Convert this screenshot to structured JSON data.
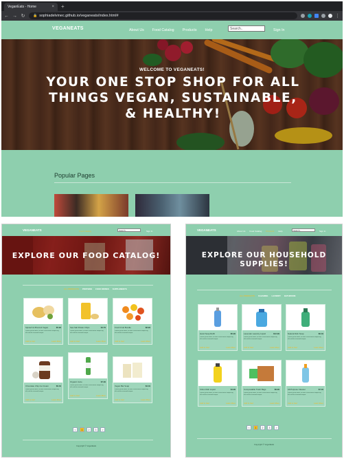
{
  "browser": {
    "tab_title": "VeganEats - Home",
    "tab_close": "×",
    "new_tab": "+",
    "url": "sophiadelvinec.github.io/veganeats/index.html#"
  },
  "site": {
    "brand": "VEGANEATS",
    "nav": [
      "About Us",
      "Food Catalog",
      "Products",
      "Help"
    ],
    "search_placeholder": "Search..",
    "signin": "Sign In"
  },
  "home": {
    "welcome": "WELCOME TO VEGANEATS!",
    "headline": "YOUR ONE STOP SHOP FOR ALL THINGS VEGAN, SUSTAINABLE, & HEALTHY!",
    "popular_heading": "Popular Pages"
  },
  "food_page": {
    "banner": "EXPLORE OUR FOOD CATALOG!",
    "tabs": [
      "ALL PRODUCTS",
      "PROTEINS",
      "FOOD DRINKS",
      "SUPPLEMENTS"
    ],
    "cards": [
      {
        "name": "Spinach & Broccoli Vegan",
        "price": "$5.99",
        "desc": "Lorem ipsum dolor sit amet consectetur adipiscing elit sed do eiusmod tempor.",
        "buy": "Add to Cart",
        "more": "Learn More"
      },
      {
        "name": "Sea Salt Potato Chips",
        "price": "$4.79",
        "desc": "Lorem ipsum dolor sit amet consectetur adipiscing elit sed do eiusmod tempor.",
        "buy": "Add to Cart",
        "more": "Learn More"
      },
      {
        "name": "Fresh Fruit Bundle",
        "price": "$8.99",
        "desc": "Lorem ipsum dolor sit amet consectetur adipiscing elit sed do eiusmod tempor.",
        "buy": "Add to Cart",
        "more": "Learn More"
      },
      {
        "name": "Chocolate Chip Ice Cream",
        "price": "$6.49",
        "desc": "Lorem ipsum dolor sit amet consectetur adipiscing elit sed do eiusmod tempor.",
        "buy": "Add to Cart",
        "more": "Learn More"
      },
      {
        "name": "Organic Juice",
        "price": "$7.99",
        "desc": "Lorem ipsum dolor sit amet consectetur adipiscing elit sed do eiusmod tempor.",
        "buy": "Add to Cart",
        "more": "Learn More"
      },
      {
        "name": "Vegan Bar Soap",
        "price": "$3.49",
        "desc": "Lorem ipsum dolor sit amet consectetur adipiscing elit sed do eiusmod tempor.",
        "buy": "Add to Cart",
        "more": "Learn More"
      }
    ],
    "pages": [
      "<",
      "1",
      "2",
      "3",
      ">"
    ],
    "footer": "Copyright © VeganEats"
  },
  "household_page": {
    "banner": "EXPLORE OUR HOUSEHOLD SUPPLIES!",
    "tabs": [
      "ALL PRODUCTS",
      "CLEANING",
      "LAUNDRY",
      "BATHROOM"
    ],
    "cards": [
      {
        "name": "Hand Soap Refill",
        "price": "$5.99",
        "desc": "Lorem ipsum dolor sit amet consectetur adipiscing elit sed do eiusmod tempor.",
        "buy": "Add to Cart",
        "more": "Learn More"
      },
      {
        "name": "Lavender Laundry Liquid",
        "price": "$12.99",
        "desc": "Lorem ipsum dolor sit amet consectetur adipiscing elit sed do eiusmod tempor.",
        "buy": "Add to Cart",
        "more": "Learn More"
      },
      {
        "name": "Natural Dish Soap",
        "price": "$6.49",
        "desc": "Lorem ipsum dolor sit amet consectetur adipiscing elit sed do eiusmod tempor.",
        "buy": "Add to Cart",
        "more": "Learn More"
      },
      {
        "name": "Citrus Dish Liquid",
        "price": "$4.99",
        "desc": "Lorem ipsum dolor sit amet consectetur adipiscing elit sed do eiusmod tempor.",
        "buy": "Add to Cart",
        "more": "Learn More"
      },
      {
        "name": "Compostable Trash Bags",
        "price": "$9.99",
        "desc": "Lorem ipsum dolor sit amet consectetur adipiscing elit sed do eiusmod tempor.",
        "buy": "Add to Cart",
        "more": "Learn More"
      },
      {
        "name": "All-Purpose Cleaner",
        "price": "$7.49",
        "desc": "Lorem ipsum dolor sit amet consectetur adipiscing elit sed do eiusmod tempor.",
        "buy": "Add to Cart",
        "more": "Learn More"
      }
    ],
    "pages": [
      "<",
      "1",
      "2",
      "3",
      ">"
    ],
    "footer": "Copyright © VeganEats"
  },
  "colors": {
    "mint": "#8ecfae",
    "accent_yellow": "#e0c040",
    "text_dark": "#1c3b2d"
  }
}
